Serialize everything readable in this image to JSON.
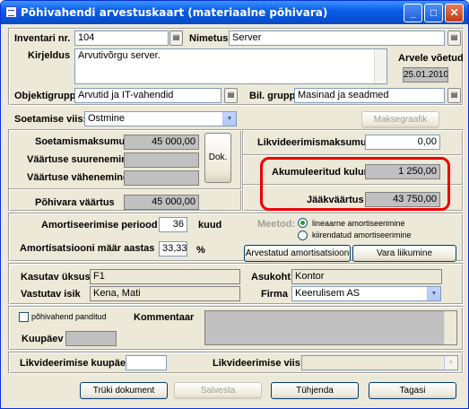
{
  "window": {
    "title": "Põhivahendi arvestuskaart (materiaalne põhivara)",
    "minimize": "_",
    "maximize": "□",
    "close": "✕"
  },
  "top": {
    "inventory_label": "Inventari nr.",
    "inventory_value": "104",
    "name_label": "Nimetus",
    "name_value": "Server",
    "description_label": "Kirjeldus",
    "description_value": "Arvutivõrgu server.",
    "accounted_label": "Arvele võetud",
    "accounted_value": "25.01.2010",
    "objectgroup_label": "Objektigrupp",
    "objectgroup_value": "Arvutid ja IT-vahendid",
    "balgroup_label": "Bil. grupp",
    "balgroup_value": "Masinad ja seadmed"
  },
  "acq": {
    "label": "Soetamise viis:",
    "value": "Ostmine",
    "schedule_button": "Maksegraafik"
  },
  "costs": {
    "acq_cost_label": "Soetamismaksumus",
    "acq_cost_value": "45 000,00",
    "increase_label": "Väärtuse suurenemine",
    "decrease_label": "Väärtuse vähenemine",
    "doc_button": "Dok.",
    "asset_value_label": "Põhivara väärtus",
    "asset_value_value": "45 000,00",
    "liq_cost_label": "Likvideerimismaksumus",
    "liq_cost_value": "0,00",
    "accum_label": "Akumuleeritud kulum",
    "accum_value": "1 250,00",
    "residual_label": "Jääkväärtus",
    "residual_value": "43 750,00"
  },
  "amort": {
    "period_label": "Amortiseerimise periood",
    "period_value": "36",
    "period_unit": "kuud",
    "rate_label": "Amortisatsiooni määr aastas",
    "rate_value": "33,33",
    "rate_unit": "%",
    "method_label": "Meetod:",
    "method_linear": "lineaarne amortiseerimine",
    "method_accel": "kiirendatud amortiseerimine",
    "calc_button": "Arvestatud amortisatsioon",
    "moves_button": "Vara liikumine"
  },
  "usage": {
    "unit_label": "Kasutav üksus",
    "unit_value": "F1",
    "location_label": "Asukoht",
    "location_value": "Kontor",
    "responsible_label": "Vastutav isik",
    "responsible_value": "Kena, Mati",
    "company_label": "Firma",
    "company_value": "Keerulisem AS"
  },
  "pledge": {
    "checkbox_label": "põhivahend panditud",
    "date_label": "Kuupäev",
    "comment_label": "Kommentaar"
  },
  "liq": {
    "date_label": "Likvideerimise kuupäev",
    "method_label": "Likvideerimise viis:"
  },
  "footer": {
    "print": "Trüki dokument",
    "save": "Salvesta",
    "clear": "Tühjenda",
    "back": "Tagasi"
  }
}
